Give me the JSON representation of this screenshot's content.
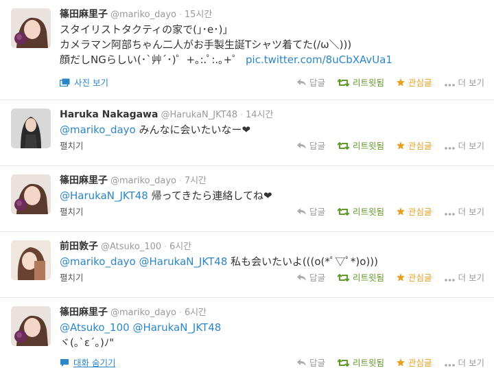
{
  "labels": {
    "reply": "답글",
    "retweet": "리트윗됨",
    "favorite": "관심글",
    "more": "더 보기",
    "expand": "펼치기",
    "view_photo": "사진 보기",
    "hide_conversation": "대화 숨기기"
  },
  "tweets": [
    {
      "fullname": "篠田麻里子",
      "username": "@mariko_dayo",
      "time": "15시간",
      "line1": "スタイリストタクティの家で(｣･e･)｣",
      "line2": "カメラマン阿部ちゃん二人がお手製生誕Tシャツ着てた(/ω＼)))",
      "line3_text": "顔だしNGらしい(･`艸´･)゜+｡:.ﾟ:.｡+゜",
      "line3_link": "pic.twitter.com/8uCbXAvUa1"
    },
    {
      "fullname": "Haruka Nakagawa",
      "username": "@HarukaN_JKT48",
      "time": "14시간",
      "mention": "@mariko_dayo",
      "text": " みんなに会いたいなー❤"
    },
    {
      "fullname": "篠田麻里子",
      "username": "@mariko_dayo",
      "time": "7시간",
      "mention": "@HarukaN_JKT48",
      "text": " 帰ってきたら連絡してね❤"
    },
    {
      "fullname": "前田敦子",
      "username": "@Atsuko_100",
      "time": "6시간",
      "mention1": "@mariko_dayo",
      "mention2": "@HarukaN_JKT48",
      "text": " 私も会いたいよ(((o(*ﾟ▽ﾟ*)o)))"
    },
    {
      "fullname": "篠田麻里子",
      "username": "@mariko_dayo",
      "time": "6시간",
      "mention1": "@Atsuko_100",
      "mention2": "@HarukaN_JKT48",
      "line2": "ヾ(｡`ε´｡)ﾉ\""
    }
  ],
  "colors": {
    "link": "#2a86c8",
    "retweet_green": "#609928",
    "favorite_orange": "#e8a020",
    "muted": "#999999"
  }
}
